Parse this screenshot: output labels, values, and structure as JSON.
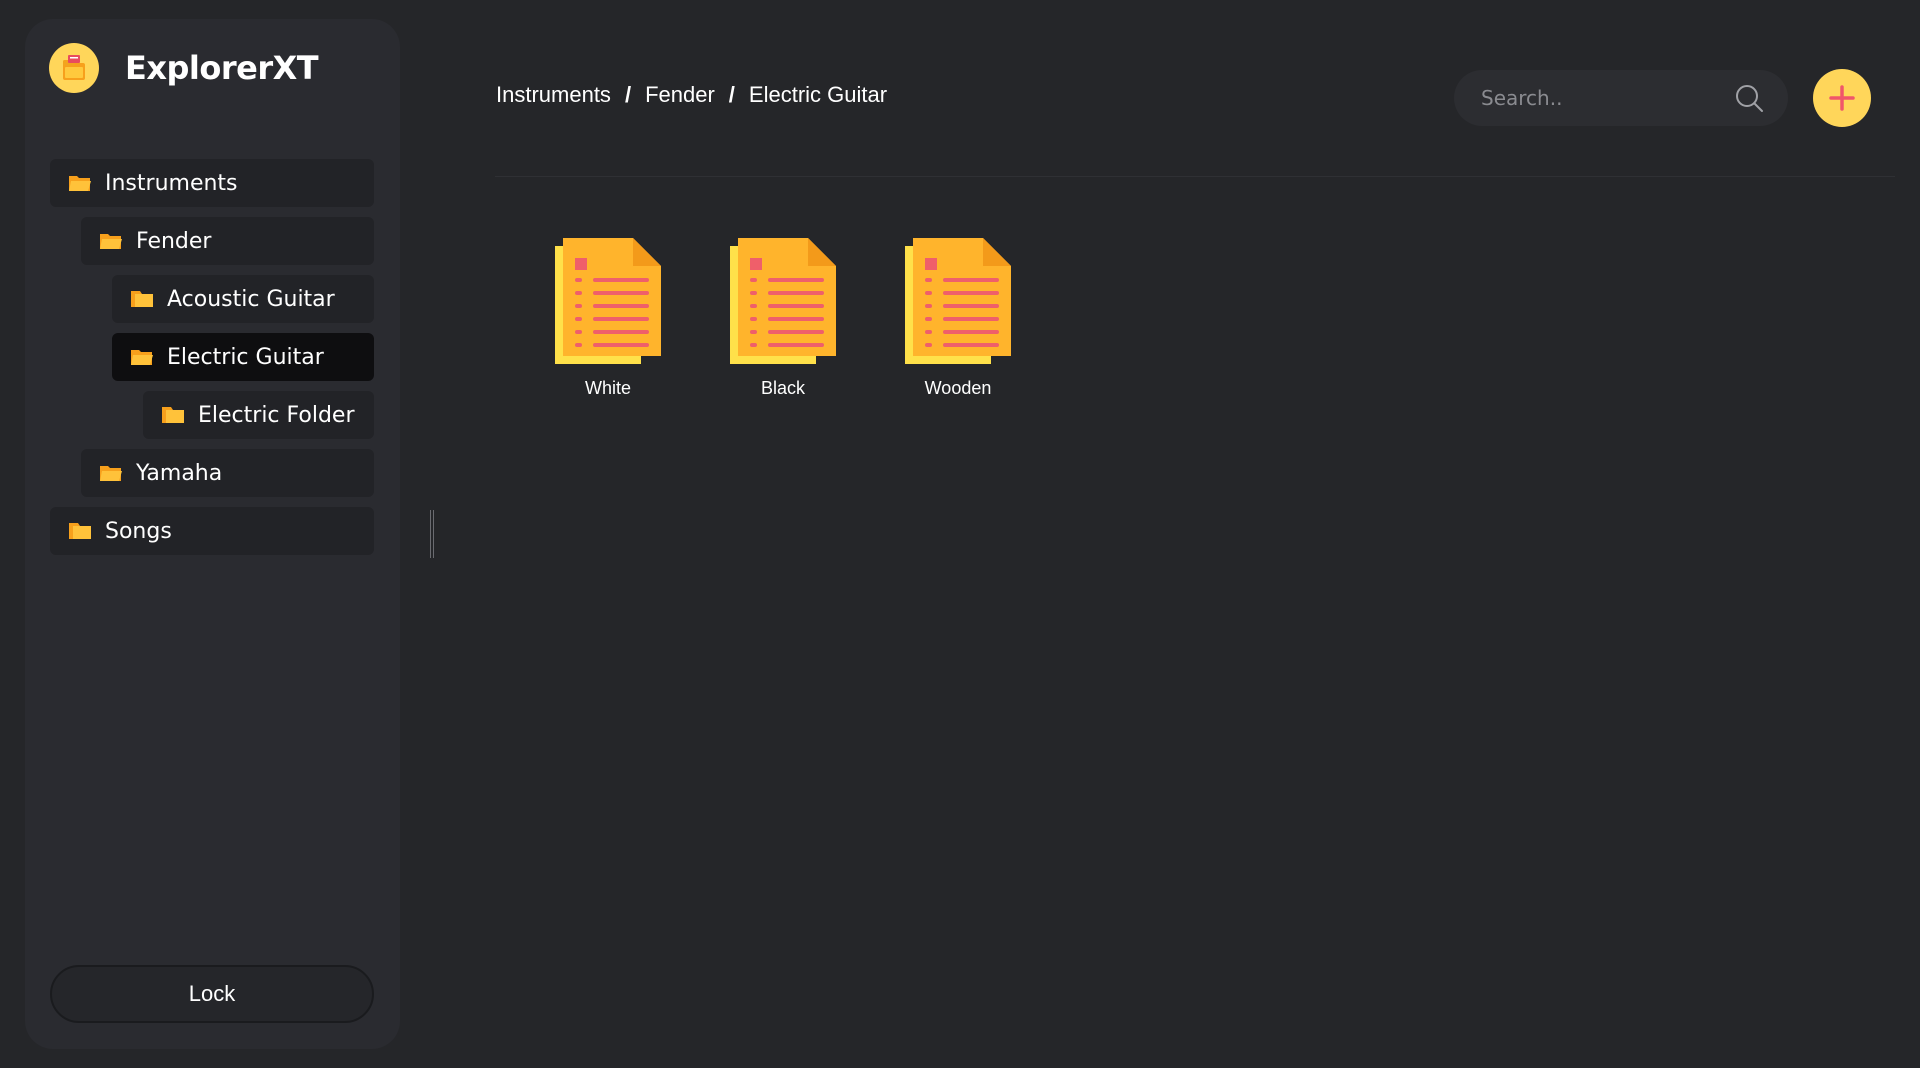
{
  "app": {
    "title": "ExplorerXT"
  },
  "sidebar": {
    "tree": [
      {
        "label": "Instruments",
        "level": 0,
        "open": true
      },
      {
        "label": "Fender",
        "level": 1,
        "open": true
      },
      {
        "label": "Acoustic Guitar",
        "level": 2,
        "open": false
      },
      {
        "label": "Electric Guitar",
        "level": 2,
        "open": true,
        "selected": true
      },
      {
        "label": "Electric Folder",
        "level": 3,
        "open": false
      },
      {
        "label": "Yamaha",
        "level": 1,
        "open": true
      },
      {
        "label": "Songs",
        "level": 0,
        "open": false
      }
    ],
    "lock_label": "Lock"
  },
  "breadcrumb": {
    "items": [
      "Instruments",
      "Fender",
      "Electric Guitar"
    ],
    "separator": "/"
  },
  "search": {
    "placeholder": "Search.."
  },
  "files": [
    {
      "name": "White",
      "icon": "document-icon"
    },
    {
      "name": "Black",
      "icon": "document-icon"
    },
    {
      "name": "Wooden",
      "icon": "document-icon"
    }
  ],
  "colors": {
    "accent": "#ffd65a",
    "accent_plus": "#f0566a",
    "folder": "#ffb92a",
    "background": "#252629",
    "sidebar": "#2a2b30"
  }
}
